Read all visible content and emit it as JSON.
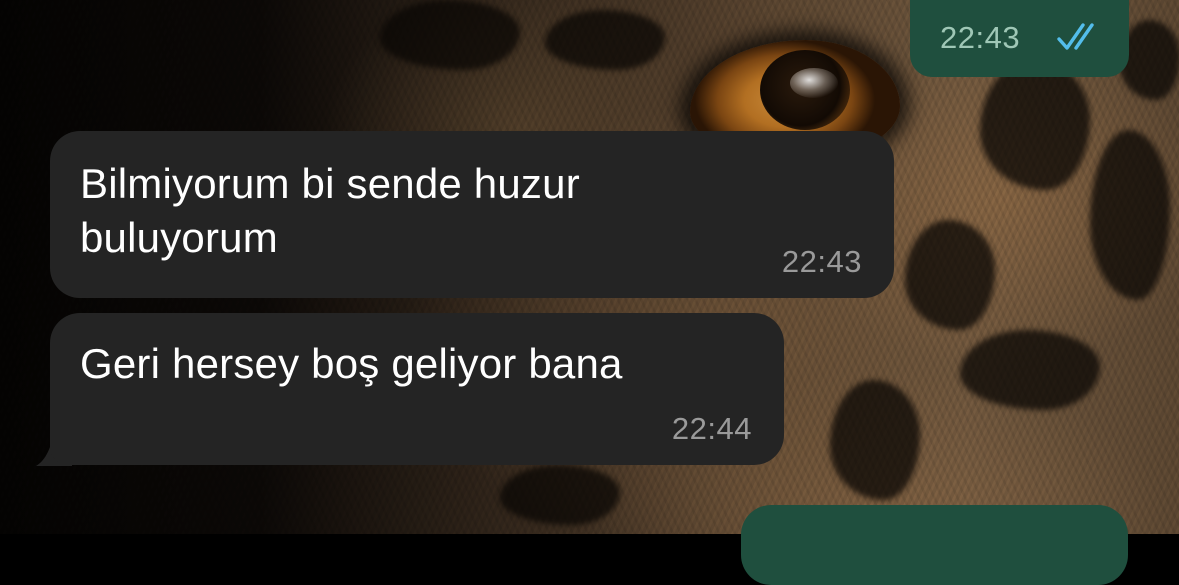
{
  "conversation": {
    "messages": [
      {
        "direction": "outgoing",
        "time": "22:43",
        "status_icon": "double-check-icon"
      },
      {
        "direction": "incoming",
        "text_line1": "Bilmiyorum bi sende huzur",
        "text_line2": "buluyorum",
        "time": "22:43"
      },
      {
        "direction": "incoming",
        "text": "Geri hersey boş geliyor bana",
        "time": "22:44"
      },
      {
        "direction": "outgoing",
        "partially_visible": true
      }
    ]
  },
  "colors": {
    "incoming_bubble": "#242424",
    "outgoing_bubble": "#1f4f3e",
    "timestamp_incoming": "#9a9a9a",
    "timestamp_outgoing": "#9fc7b6",
    "read_receipt": "#53bdeb",
    "text": "#ffffff"
  },
  "wallpaper": {
    "subject": "leopard-eye-closeup"
  }
}
